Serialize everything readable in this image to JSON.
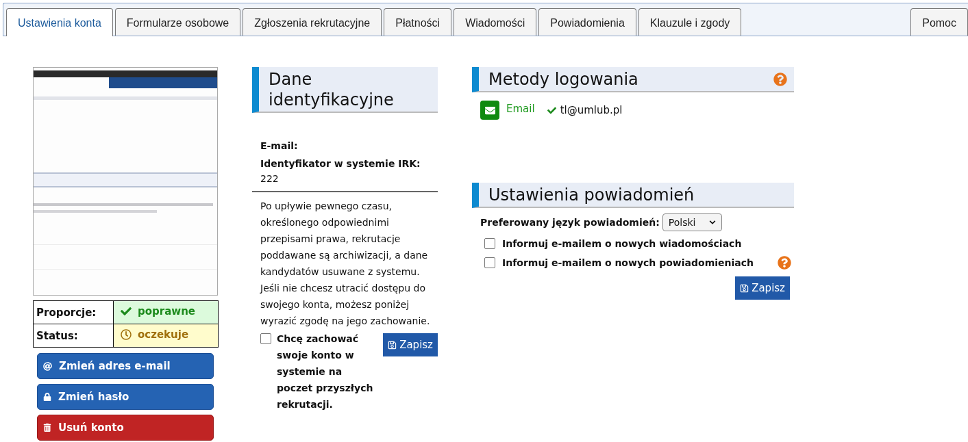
{
  "tabs": [
    {
      "label": "Ustawienia konta",
      "selected": true
    },
    {
      "label": "Formularze osobowe",
      "selected": false
    },
    {
      "label": "Zgłoszenia rekrutacyjne",
      "selected": false
    },
    {
      "label": "Płatności",
      "selected": false
    },
    {
      "label": "Wiadomości",
      "selected": false
    },
    {
      "label": "Powiadomienia",
      "selected": false
    },
    {
      "label": "Klauzule i zgody",
      "selected": false
    }
  ],
  "help_tab": {
    "label": "Pomoc",
    "selected": false
  },
  "photo_status": [
    {
      "label": "Proporcje:",
      "value": "poprawne",
      "kind": "ok"
    },
    {
      "label": "Status:",
      "value": "oczekuje",
      "kind": "pending"
    }
  ],
  "account_buttons": [
    {
      "label": "Zmień adres e-mail",
      "kind": "email"
    },
    {
      "label": "Zmień hasło",
      "kind": "password"
    },
    {
      "label": "Usuń konto",
      "kind": "delete"
    }
  ],
  "identity": {
    "title": "Dane identyfikacyjne",
    "fields": [
      {
        "label": "E-mail:"
      },
      {
        "label": "Identyfikator w systemie IRK:",
        "value": "222"
      }
    ],
    "notice": "Po upływie pewnego czasu, określonego odpowiednimi przepisami prawa, rekrutacje poddawane są archiwizacji, a dane kandydatów usuwane z systemu. Jeśli nie chcesz utracić dostępu do swojego konta, możesz poniżej wyrazić zgodę na jego zachowanie.",
    "keep_account": {
      "label": "Chcę zachować swoje konto w systemie na poczet przyszłych rekrutacji.",
      "checked": false
    },
    "save_button": "Zapisz"
  },
  "login_methods": {
    "title": "Metody logowania",
    "methods": [
      {
        "label": "Email",
        "value": "tl@umlub.pl",
        "verified": true
      }
    ]
  },
  "notification_settings": {
    "title": "Ustawienia powiadomień",
    "language_label": "Preferowany język powiadomień:",
    "language_value": "Polski",
    "options": [
      {
        "label": "Informuj e-mailem o nowych wiadomościach",
        "checked": false,
        "help": false
      },
      {
        "label": "Informuj e-mailem o nowych powiadomieniach",
        "checked": false,
        "help": true
      }
    ],
    "save_button": "Zapisz"
  }
}
